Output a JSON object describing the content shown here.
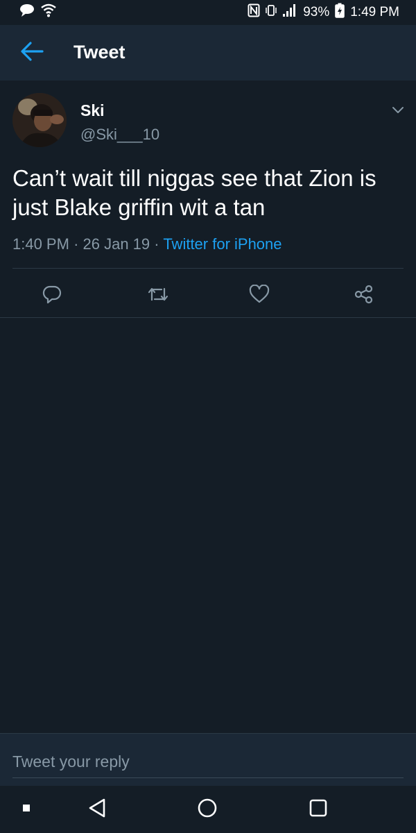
{
  "status_bar": {
    "battery_percent": "93%",
    "time": "1:49 PM",
    "icons": [
      "chat-icon",
      "wifi-icon",
      "nfc-icon",
      "vibrate-icon",
      "signal-icon",
      "battery-icon"
    ]
  },
  "header": {
    "title": "Tweet",
    "back_icon": "arrow-left-icon"
  },
  "tweet": {
    "author_name": "Ski",
    "author_handle": "@Ski___10",
    "text": "Can’t wait till niggas see that Zion is just Blake griffin wit a tan",
    "time": "1:40 PM",
    "date": "26 Jan 19",
    "separator": "·",
    "source": "Twitter for iPhone",
    "actions": [
      "reply-icon",
      "retweet-icon",
      "like-icon",
      "share-icon"
    ]
  },
  "reply_bar": {
    "placeholder": "Tweet your reply"
  },
  "colors": {
    "background": "#141d26",
    "bar": "#1b2836",
    "accent": "#1da1f2",
    "secondary_text": "#8899a6"
  }
}
